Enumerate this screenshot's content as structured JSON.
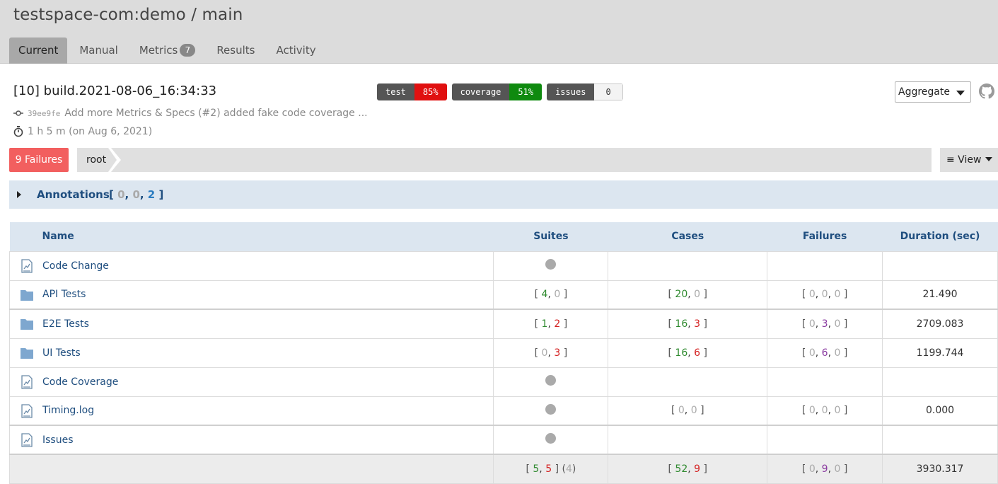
{
  "app_title": "testspace-com:demo / main",
  "tabs": [
    {
      "label": "Current",
      "active": true
    },
    {
      "label": "Manual"
    },
    {
      "label": "Metrics",
      "count": "7"
    },
    {
      "label": "Results"
    },
    {
      "label": "Activity"
    }
  ],
  "build": {
    "title": "[10] build.2021-08-06_16:34:33",
    "commit_hash": "39ee9fe",
    "commit_message": "Add more Metrics & Specs (#2) added fake code coverage ...",
    "duration": "1 h 5 m (on Aug 6, 2021)"
  },
  "badges": [
    {
      "label": "test",
      "value": "85%",
      "color": "#e01010"
    },
    {
      "label": "coverage",
      "value": "51%",
      "color": "#0f8a0f"
    },
    {
      "label": "issues",
      "value": "0",
      "color": "#f3f3f3"
    }
  ],
  "aggregate_select": "Aggregate",
  "failures_badge": "9 Failures",
  "breadcrumb_root": "root",
  "view_button": "≡ View",
  "annotations": {
    "label": "Annotations",
    "values": [
      "0",
      "0",
      "2"
    ]
  },
  "table": {
    "headers": [
      "Name",
      "Suites",
      "Cases",
      "Failures",
      "Duration (sec)"
    ],
    "rows": [
      {
        "name": "Code Change",
        "icon": "document-icon",
        "suites_dot": true
      },
      {
        "name": "API Tests",
        "icon": "folder-icon",
        "suites": [
          "4",
          "0"
        ],
        "cases": [
          "20",
          "0"
        ],
        "failures": [
          "0",
          "0",
          "0"
        ],
        "duration": "21.490"
      },
      {
        "name": "E2E Tests",
        "icon": "folder-icon",
        "suites": [
          "1",
          "2"
        ],
        "cases": [
          "16",
          "3"
        ],
        "failures": [
          "0",
          "3",
          "0"
        ],
        "duration": "2709.083"
      },
      {
        "name": "UI Tests",
        "icon": "folder-icon",
        "suites": [
          "0",
          "3"
        ],
        "cases": [
          "16",
          "6"
        ],
        "failures": [
          "0",
          "6",
          "0"
        ],
        "duration": "1199.744"
      },
      {
        "name": "Code Coverage",
        "icon": "document-icon",
        "suites_dot": true
      },
      {
        "name": "Timing.log",
        "icon": "document-icon",
        "suites_dot": true,
        "cases": [
          "0",
          "0"
        ],
        "failures": [
          "0",
          "0",
          "0"
        ],
        "duration": "0.000"
      },
      {
        "name": "Issues",
        "icon": "document-icon",
        "suites_dot": true
      }
    ],
    "total": {
      "suites": [
        "5",
        "5"
      ],
      "suites_extra": "4",
      "cases": [
        "52",
        "9"
      ],
      "failures": [
        "0",
        "9",
        "0"
      ],
      "duration": "3930.317"
    }
  }
}
